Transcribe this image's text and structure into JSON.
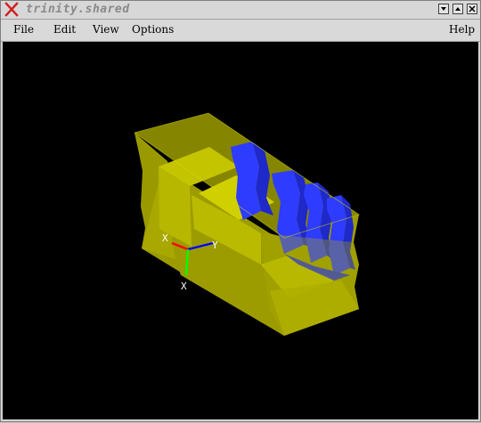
{
  "window": {
    "title": "trinity.shared",
    "close_icon": "x-close-icon",
    "buttons": [
      "minimize-icon",
      "maximize-icon",
      "close-icon"
    ]
  },
  "menubar": {
    "file": "File",
    "edit": "Edit",
    "view": "View",
    "options": "Options",
    "help": "Help"
  },
  "viewport": {
    "background": "#000000",
    "model_color": "#b8b800",
    "feature_color": "#2e3cff",
    "axis_colors": {
      "x": "#ff0000",
      "y": "#00ff00",
      "z": "#0000ff"
    },
    "axis_labels": {
      "a": "X",
      "b": "Y",
      "c": "X"
    }
  }
}
